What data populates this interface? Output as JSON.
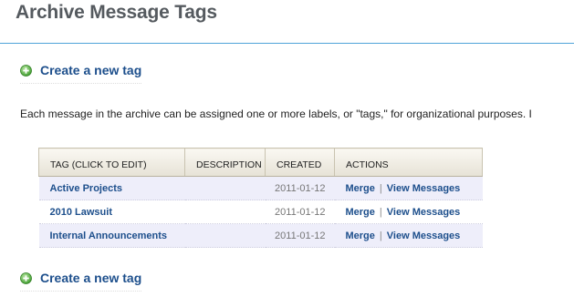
{
  "header": {
    "title": "Archive Message Tags"
  },
  "create_top": {
    "label": "Create a new tag",
    "icon": "plus-circle-icon",
    "icon_color": "#5cb85c"
  },
  "intro_text": "Each message in the archive can be assigned one or more labels, or \"tags,\" for organizational purposes. I",
  "table": {
    "columns": [
      "TAG (CLICK TO EDIT)",
      "DESCRIPTION",
      "CREATED",
      "ACTIONS"
    ],
    "rows": [
      {
        "name": "Active Projects",
        "description": "",
        "created": "2011-01-12",
        "merge": "Merge",
        "separator": "|",
        "view": "View Messages"
      },
      {
        "name": "2010 Lawsuit",
        "description": "",
        "created": "2011-01-12",
        "merge": "Merge",
        "separator": "|",
        "view": "View Messages"
      },
      {
        "name": "Internal Announcements",
        "description": "",
        "created": "2011-01-12",
        "merge": "Merge",
        "separator": "|",
        "view": "View Messages"
      }
    ]
  },
  "create_bottom": {
    "label": "Create a new tag",
    "icon": "plus-circle-icon",
    "icon_color": "#5cb85c"
  },
  "colors": {
    "link": "#1d4f8c",
    "header_rule": "#4fa3d9",
    "row_shade": "#eeeefa",
    "title": "#555a5f"
  }
}
